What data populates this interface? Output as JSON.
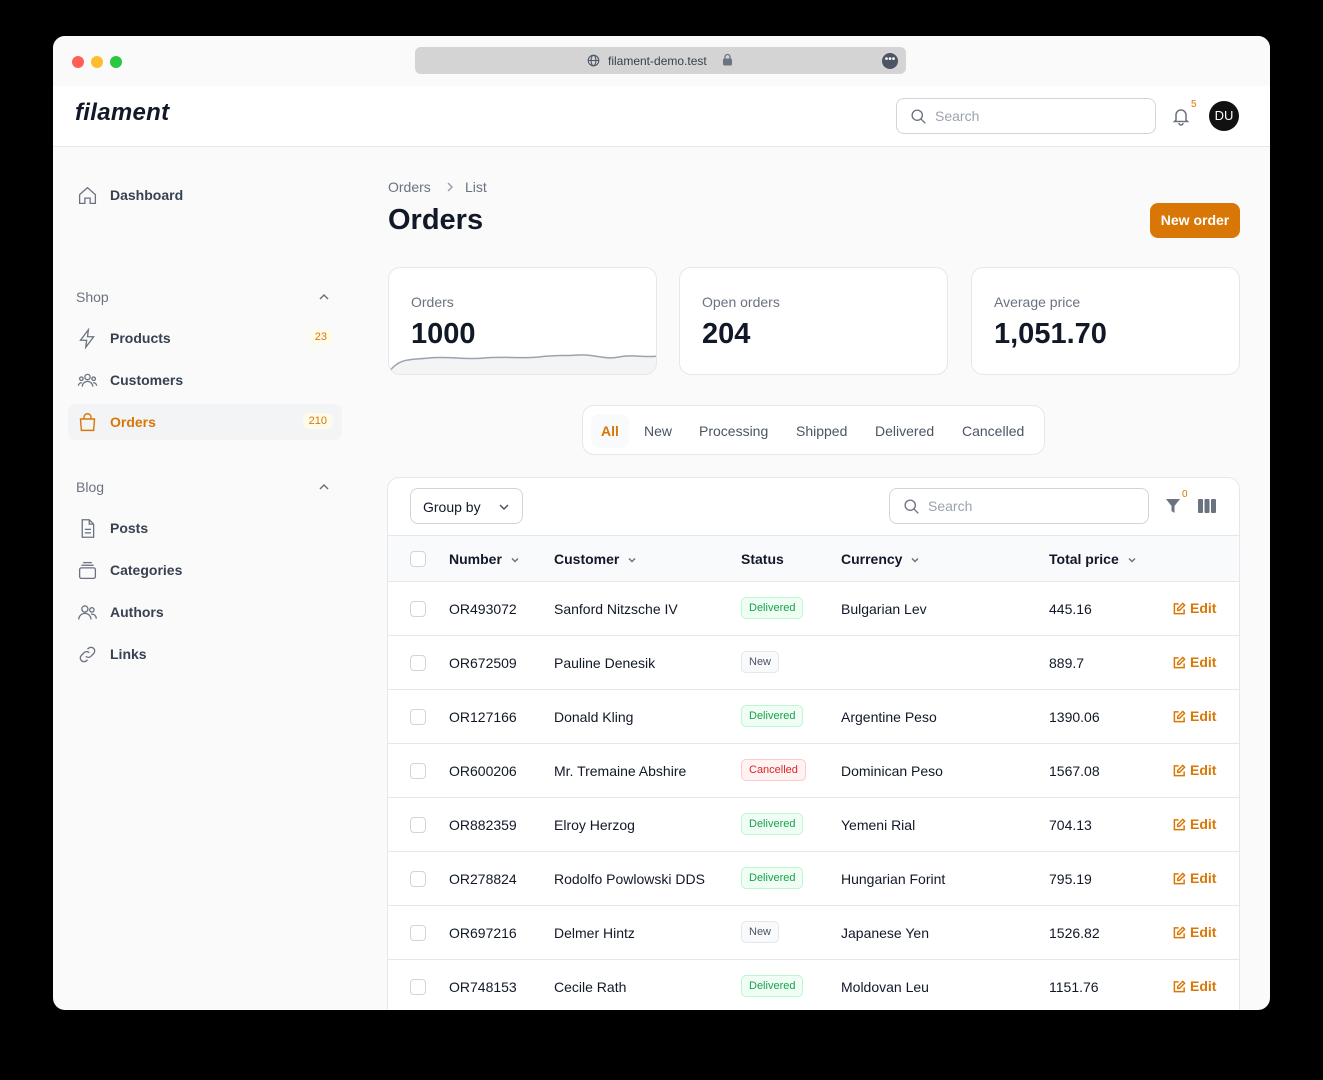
{
  "browser": {
    "url": "filament-demo.test"
  },
  "topbar": {
    "logo": "filament",
    "search_placeholder": "Search",
    "notification_count": "5",
    "avatar_initials": "DU"
  },
  "sidebar": {
    "dashboard": "Dashboard",
    "shop_label": "Shop",
    "products": "Products",
    "products_count": "23",
    "customers": "Customers",
    "orders": "Orders",
    "orders_count": "210",
    "blog_label": "Blog",
    "posts": "Posts",
    "categories": "Categories",
    "authors": "Authors",
    "links": "Links"
  },
  "main": {
    "breadcrumb": [
      "Orders",
      "List"
    ],
    "title": "Orders",
    "new_order": "New order",
    "stats": [
      {
        "label": "Orders",
        "value": "1000"
      },
      {
        "label": "Open orders",
        "value": "204"
      },
      {
        "label": "Average price",
        "value": "1,051.70"
      }
    ],
    "tabs": [
      "All",
      "New",
      "Processing",
      "Shipped",
      "Delivered",
      "Cancelled"
    ],
    "group_by": "Group by",
    "table_search_placeholder": "Search",
    "filter_count": "0",
    "columns": [
      "Number",
      "Customer",
      "Status",
      "Currency",
      "Total price"
    ],
    "edit_label": "Edit",
    "rows": [
      {
        "number": "OR493072",
        "customer": "Sanford Nitzsche IV",
        "status": "Delivered",
        "currency": "Bulgarian Lev",
        "total": "445.16"
      },
      {
        "number": "OR672509",
        "customer": "Pauline Denesik",
        "status": "New",
        "currency": "",
        "total": "889.7"
      },
      {
        "number": "OR127166",
        "customer": "Donald Kling",
        "status": "Delivered",
        "currency": "Argentine Peso",
        "total": "1390.06"
      },
      {
        "number": "OR600206",
        "customer": "Mr. Tremaine Abshire",
        "status": "Cancelled",
        "currency": "Dominican Peso",
        "total": "1567.08"
      },
      {
        "number": "OR882359",
        "customer": "Elroy Herzog",
        "status": "Delivered",
        "currency": "Yemeni Rial",
        "total": "704.13"
      },
      {
        "number": "OR278824",
        "customer": "Rodolfo Powlowski DDS",
        "status": "Delivered",
        "currency": "Hungarian Forint",
        "total": "795.19"
      },
      {
        "number": "OR697216",
        "customer": "Delmer Hintz",
        "status": "New",
        "currency": "Japanese Yen",
        "total": "1526.82"
      },
      {
        "number": "OR748153",
        "customer": "Cecile Rath",
        "status": "Delivered",
        "currency": "Moldovan Leu",
        "total": "1151.76"
      }
    ]
  },
  "colors": {
    "accent": "#d97706",
    "delivered": "#16a34a",
    "cancelled": "#dc2626"
  }
}
